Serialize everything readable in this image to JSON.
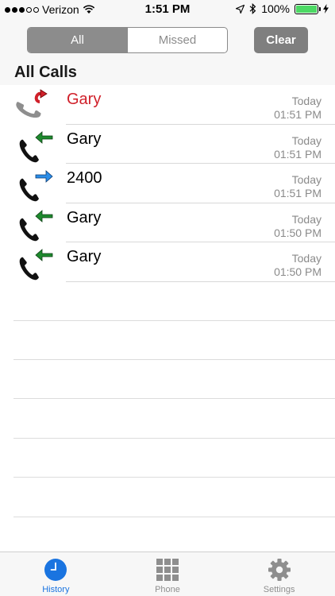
{
  "status_bar": {
    "carrier": "Verizon",
    "time": "1:51 PM",
    "battery": "100%",
    "signal_bars_filled": 3,
    "signal_bars_total": 5
  },
  "filter": {
    "options": [
      "All",
      "Missed"
    ],
    "selected": "All",
    "clear_label": "Clear"
  },
  "section_title": "All Calls",
  "calls": [
    {
      "name": "Gary",
      "type": "missed",
      "date": "Today",
      "time": "01:51 PM"
    },
    {
      "name": "Gary",
      "type": "incoming",
      "date": "Today",
      "time": "01:51 PM"
    },
    {
      "name": "2400",
      "type": "outgoing",
      "date": "Today",
      "time": "01:51 PM"
    },
    {
      "name": "Gary",
      "type": "incoming",
      "date": "Today",
      "time": "01:50 PM"
    },
    {
      "name": "Gary",
      "type": "incoming",
      "date": "Today",
      "time": "01:50 PM"
    }
  ],
  "tabs": [
    {
      "label": "History",
      "icon": "clock-icon",
      "active": true
    },
    {
      "label": "Phone",
      "icon": "keypad-icon",
      "active": false
    },
    {
      "label": "Settings",
      "icon": "gear-icon",
      "active": false
    }
  ],
  "colors": {
    "missed": "#d0202a",
    "incoming_arrow": "#1e8a2e",
    "outgoing_arrow": "#2a8de8",
    "accent": "#1a74e0"
  }
}
